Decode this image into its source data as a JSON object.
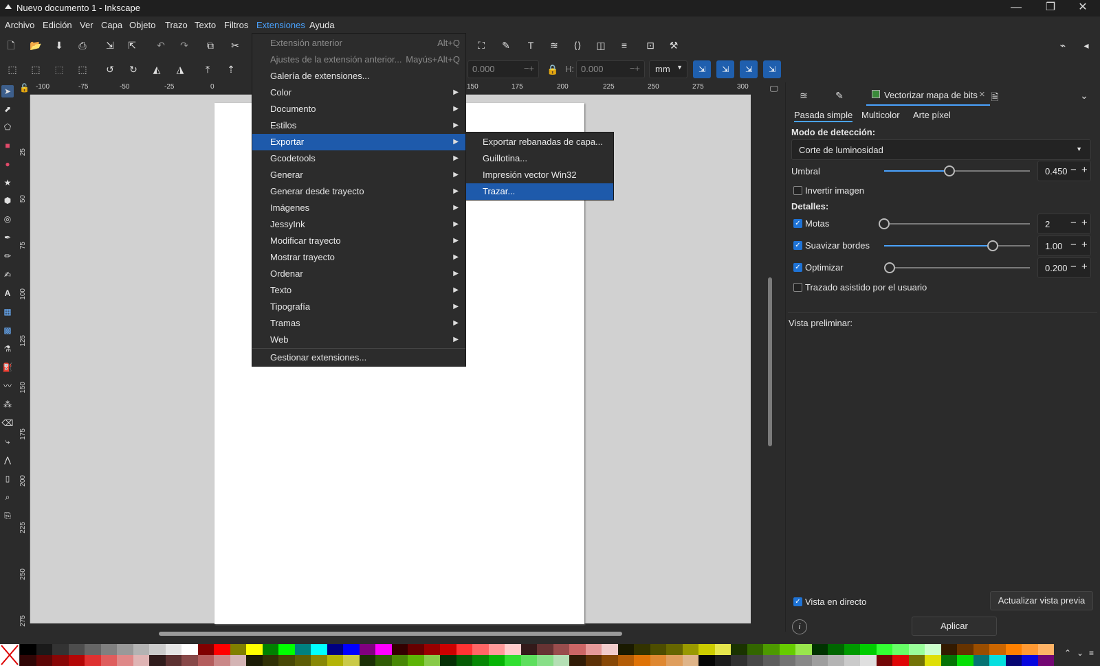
{
  "window": {
    "title": "Nuevo documento 1 - Inkscape",
    "minimize": "—",
    "maximize": "❐",
    "close": "✕"
  },
  "menubar": [
    "Archivo",
    "Edición",
    "Ver",
    "Capa",
    "Objeto",
    "Trazo",
    "Texto",
    "Filtros",
    "Extensiones",
    "Ayuda"
  ],
  "toolbar": {
    "w_value": "0.000",
    "h_label": "H:",
    "h_value": "0.000",
    "unit": "mm"
  },
  "ruler_top": [
    "-100",
    "-75",
    "-50",
    "-25",
    "0",
    "150",
    "175",
    "200",
    "225",
    "250",
    "275",
    "300"
  ],
  "ruler_left": [
    "25",
    "50",
    "75",
    "100",
    "125",
    "150",
    "175",
    "200",
    "225",
    "250",
    "275"
  ],
  "extensions_menu": [
    {
      "label": "Extensión anterior",
      "shortcut": "Alt+Q",
      "disabled": true
    },
    {
      "label": "Ajustes de la extensión anterior...",
      "shortcut": "Mayús+Alt+Q",
      "disabled": true
    },
    {
      "label": "Galería de extensiones..."
    },
    {
      "label": "Color",
      "submenu": true
    },
    {
      "label": "Documento",
      "submenu": true
    },
    {
      "label": "Estilos",
      "submenu": true
    },
    {
      "label": "Exportar",
      "submenu": true,
      "highlighted": true
    },
    {
      "label": "Gcodetools",
      "submenu": true
    },
    {
      "label": "Generar",
      "submenu": true
    },
    {
      "label": "Generar desde trayecto",
      "submenu": true
    },
    {
      "label": "Imágenes",
      "submenu": true
    },
    {
      "label": "JessyInk",
      "submenu": true
    },
    {
      "label": "Modificar trayecto",
      "submenu": true
    },
    {
      "label": "Mostrar trayecto",
      "submenu": true
    },
    {
      "label": "Ordenar",
      "submenu": true
    },
    {
      "label": "Texto",
      "submenu": true
    },
    {
      "label": "Tipografía",
      "submenu": true
    },
    {
      "label": "Tramas",
      "submenu": true
    },
    {
      "label": "Web",
      "submenu": true
    },
    {
      "label": "Gestionar extensiones..."
    }
  ],
  "export_submenu": [
    {
      "label": "Exportar rebanadas de capa..."
    },
    {
      "label": "Guillotina..."
    },
    {
      "label": "Impresión vector Win32"
    },
    {
      "label": "Trazar...",
      "highlighted": true
    }
  ],
  "dock": {
    "active_tab": "Vectorizar mapa de bits",
    "close": "×",
    "subtabs": [
      "Pasada simple",
      "Multicolor",
      "Arte píxel"
    ],
    "detection_mode_label": "Modo de detección:",
    "detection_mode_value": "Corte de luminosidad",
    "threshold_label": "Umbral",
    "threshold_value": "0.450",
    "threshold_level": 0.45,
    "invert_label": "Invertir imagen",
    "details_label": "Detalles:",
    "specks_label": "Motas",
    "specks_value": "2",
    "smooth_label": "Suavizar bordes",
    "smooth_value": "1.00",
    "optimize_label": "Optimizar",
    "optimize_value": "0.200",
    "assisted_label": "Trazado asistido por el usuario",
    "preview_label": "Vista preliminar:",
    "live_preview_label": "Vista en directo",
    "update_preview_button": "Actualizar vista previa",
    "apply_button": "Aplicar",
    "minus": "−",
    "plus": "+"
  },
  "palette_colors": [
    "#000000",
    "#1a1a1a",
    "#333333",
    "#4d4d4d",
    "#666666",
    "#808080",
    "#999999",
    "#b3b3b3",
    "#cccccc",
    "#e6e6e6",
    "#ffffff",
    "#800000",
    "#ff0000",
    "#808000",
    "#ffff00",
    "#008000",
    "#00ff00",
    "#008080",
    "#00ffff",
    "#000080",
    "#0000ff",
    "#800080",
    "#ff00ff",
    "#330000",
    "#660000",
    "#990000",
    "#cc0000",
    "#ff3333",
    "#ff6666",
    "#ff9999",
    "#ffcccc",
    "#331a1a",
    "#663333",
    "#994d4d",
    "#cc6666",
    "#e69999",
    "#f2cccc",
    "#1a1a00",
    "#333300",
    "#4d4d00",
    "#666600",
    "#999900",
    "#cccc00",
    "#e6e64d",
    "#1a3300",
    "#336600",
    "#4d9900",
    "#66cc00",
    "#99e64d",
    "#003300",
    "#006600",
    "#009900",
    "#00cc00",
    "#33ff33",
    "#66ff66",
    "#99ff99",
    "#ccffcc",
    "#331a00",
    "#663300",
    "#994d00",
    "#cc6600",
    "#ff8000",
    "#ff9933",
    "#ffb366",
    "#ffcc99"
  ]
}
